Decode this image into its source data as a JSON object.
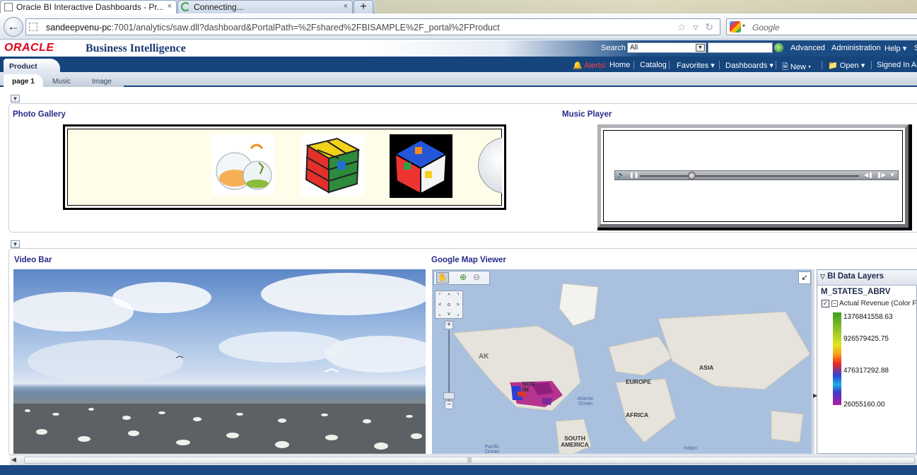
{
  "browser": {
    "tabs": [
      {
        "title": "Oracle BI Interactive Dashboards - Pr...",
        "close": "×"
      },
      {
        "title": "Connecting...",
        "close": "×"
      }
    ],
    "new_tab": "+",
    "url_host": "sandeepvenu-pc",
    "url_rest": ":7001/analytics/saw.dll?dashboard&PortalPath=%2Fshared%2FBISAMPLE%2F_portal%2FProduct",
    "search_engine_placeholder": "Google"
  },
  "header": {
    "oracle": "ORACLE",
    "product": "Business Intelligence",
    "search_label": "Search",
    "search_scope": "All",
    "advanced": "Advanced",
    "administration": "Administration",
    "help": "Help",
    "help_arrow": "▾",
    "cut": "S"
  },
  "menubar": {
    "dashboard_tab": "Product",
    "alerts": "Alerts!",
    "home": "Home",
    "catalog": "Catalog",
    "favorites": "Favorites ▾",
    "dashboards": "Dashboards ▾",
    "new": "New ▾",
    "open": "Open ▾",
    "signed_in": "Signed In As"
  },
  "page_tabs": [
    "page 1",
    "Music",
    "Image"
  ],
  "sections": {
    "photo_gallery_title": "Photo Gallery",
    "music_player_title": "Music Player",
    "video_bar_title": "Video Bar",
    "map_title": "Google Map Viewer"
  },
  "map": {
    "labels": {
      "ak": "AK",
      "europe": "EUROPE",
      "asia": "ASIA",
      "africa": "AFRICA",
      "south_america": "SOUTH AMERICA",
      "atlantic": "Atlantic Ocean",
      "pacific": "Pacific Ocean",
      "indian": "Indian",
      "nor": "NOR",
      "im": "IM"
    }
  },
  "layers": {
    "title": "BI Data Layers",
    "layer_name": "M_STATES_ABRV",
    "series": "Actual Revenue (Color F",
    "legend_values": [
      "1376841558.63",
      "926579425.75",
      "476317292.88",
      "26055160.00"
    ]
  },
  "colors": {
    "brand_blue": "#16447d",
    "oracle_red": "#e2001a",
    "title_blue": "#262b86"
  }
}
